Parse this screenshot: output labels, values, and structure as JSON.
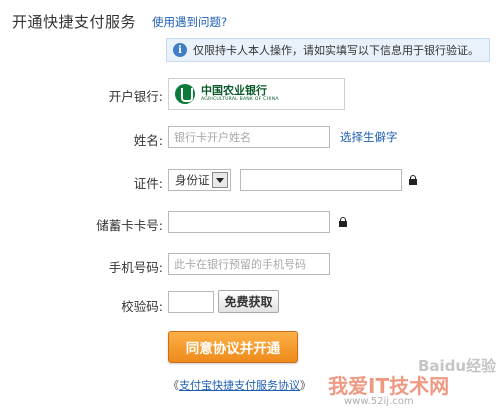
{
  "header": {
    "title": "开通快捷支付服务",
    "help_link": "使用遇到问题?"
  },
  "notice": {
    "text": "仅限持卡人本人操作，请如实填写以下信息用于银行验证。"
  },
  "bank": {
    "label": "开户银行:",
    "name_cn": "中国农业银行",
    "name_en": "AGRICULTURAL BANK OF CHINA"
  },
  "name_row": {
    "label": "姓名:",
    "placeholder": "银行卡开户姓名",
    "value": "",
    "pick_link": "选择生僻字"
  },
  "id_row": {
    "label": "证件:",
    "id_type": "身份证",
    "value": ""
  },
  "card_row": {
    "label": "储蓄卡卡号:",
    "value": ""
  },
  "phone_row": {
    "label": "手机号码:",
    "placeholder": "此卡在银行预留的手机号码",
    "value": ""
  },
  "code_row": {
    "label": "校验码:",
    "value": "",
    "get_code_button": "免费获取"
  },
  "submit_button": "同意协议并开通",
  "agreement": {
    "prefix": "《",
    "link": "支付宝快捷支付服务协议",
    "suffix": "》"
  },
  "watermarks": {
    "baidu": "Baidu经验",
    "site": "我爱IT技术网",
    "url": "www.52ij.com"
  },
  "colors": {
    "link": "#1f5fb5",
    "submit": "#f08a1b",
    "notice_bg": "#e9f1fb",
    "bank_green": "#0b7a3a"
  }
}
